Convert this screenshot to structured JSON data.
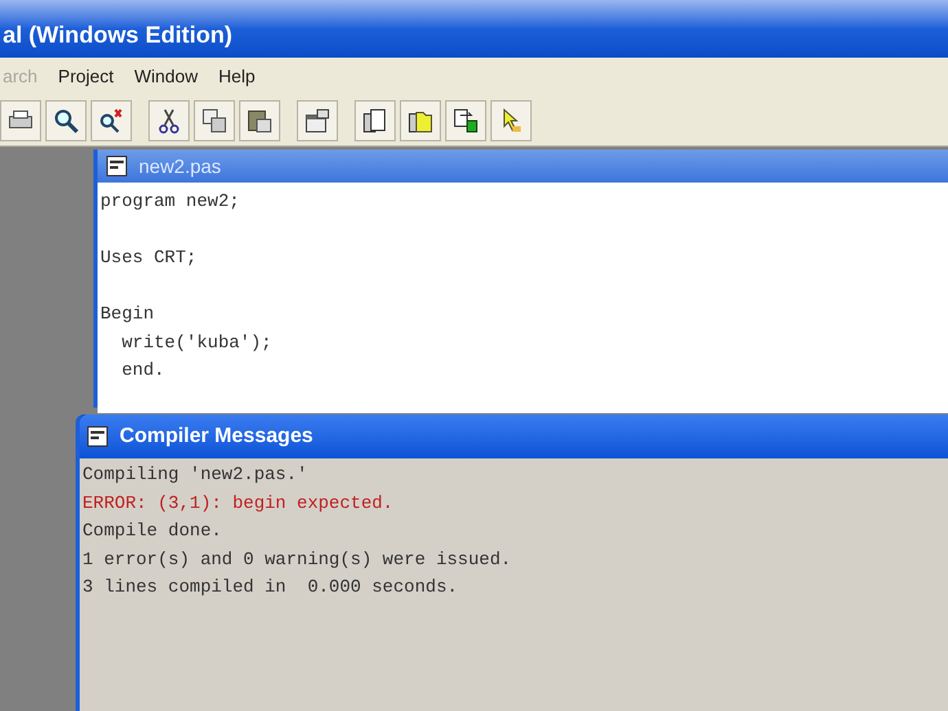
{
  "window": {
    "title": "al (Windows Edition)"
  },
  "menu": [
    {
      "label": "arch",
      "disabled": true
    },
    {
      "label": "Project",
      "disabled": false
    },
    {
      "label": "Window",
      "disabled": false
    },
    {
      "label": "Help",
      "disabled": false
    }
  ],
  "editor": {
    "title": "new2.pas",
    "blocks": [
      [
        "program new2;"
      ],
      [
        "Uses CRT;"
      ],
      [
        "Begin",
        "  write('kuba');",
        "  end."
      ]
    ]
  },
  "compiler": {
    "title": "Compiler Messages",
    "messages": [
      {
        "text": "Compiling 'new2.pas.'",
        "kind": "info"
      },
      {
        "text": "ERROR: (3,1): begin expected.",
        "kind": "error"
      },
      {
        "text": "Compile done.",
        "kind": "info"
      },
      {
        "text": "1 error(s) and 0 warning(s) were issued.",
        "kind": "info"
      },
      {
        "text": "3 lines compiled in  0.000 seconds.",
        "kind": "info"
      }
    ]
  }
}
